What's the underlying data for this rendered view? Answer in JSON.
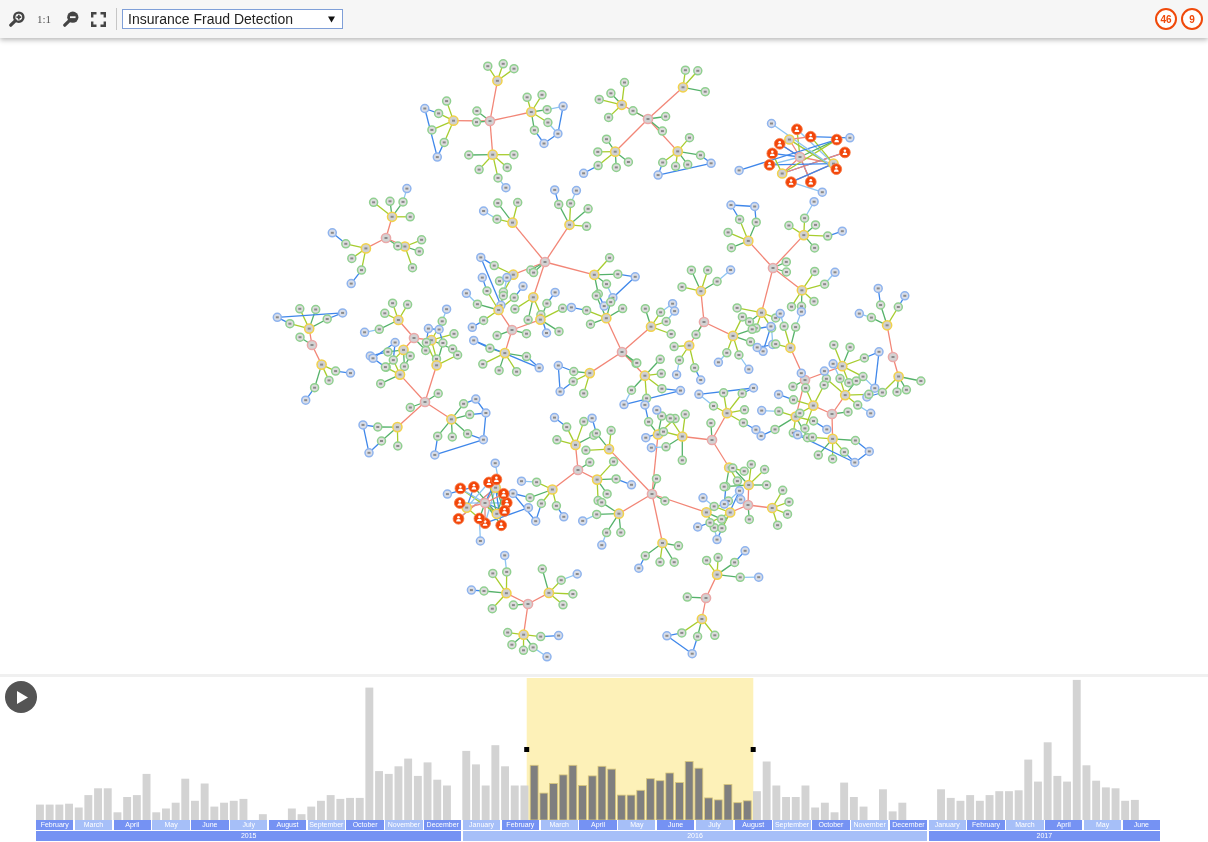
{
  "toolbar": {
    "actual_size_button": "1:1",
    "view_dropdown": {
      "value": "Insurance Fraud Detection"
    },
    "alert_counts": [
      {
        "count": "46"
      },
      {
        "count": "9"
      }
    ]
  },
  "timeline": {
    "years": [
      {
        "label": "2015",
        "months": [
          "February",
          "March",
          "April",
          "May",
          "June",
          "July",
          "August",
          "September",
          "October",
          "November",
          "December"
        ]
      },
      {
        "label": "2016",
        "months": [
          "January",
          "February",
          "March",
          "April",
          "May",
          "June",
          "July",
          "August",
          "September",
          "October",
          "November",
          "December"
        ]
      },
      {
        "label": "2017",
        "months": [
          "January",
          "February",
          "March",
          "April",
          "May",
          "June"
        ]
      }
    ]
  }
}
